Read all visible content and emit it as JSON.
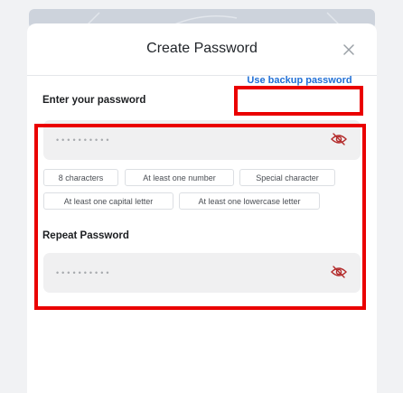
{
  "modal": {
    "title": "Create Password"
  },
  "password_field": {
    "label": "Enter your password",
    "masked_value": "••••••••••"
  },
  "backup_link": {
    "label": "Use backup password"
  },
  "requirements": [
    "8 characters",
    "At least one number",
    "Special character",
    "At least one capital letter",
    "At least one lowercase letter"
  ],
  "repeat_field": {
    "label": "Repeat Password",
    "masked_value": "••••••••••"
  },
  "colors": {
    "accent_link": "#1f6fd6",
    "highlight_box": "#ea0000",
    "eye_icon": "#b32a2a"
  },
  "icons": [
    "close-icon",
    "eye-slash-icon"
  ]
}
